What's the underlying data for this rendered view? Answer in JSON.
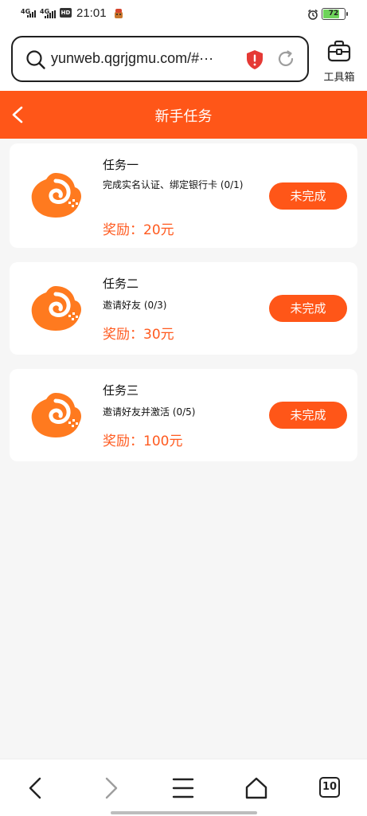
{
  "status_bar": {
    "network_1": "4G",
    "network_2": "4G",
    "hd": "HD",
    "time": "21:01",
    "battery": "72"
  },
  "browser": {
    "url": "yunweb.qgrjgmu.com/#···",
    "toolbox_label": "工具箱",
    "tab_count": "10"
  },
  "page": {
    "title": "新手任务"
  },
  "tasks": [
    {
      "title": "任务一",
      "desc": "完成实名认证、绑定银行卡 (0/1)",
      "reward": "奖励：20元",
      "status": "未完成"
    },
    {
      "title": "任务二",
      "desc": "邀请好友 (0/3)",
      "reward": "奖励：30元",
      "status": "未完成"
    },
    {
      "title": "任务三",
      "desc": "邀请好友并激活 (0/5)",
      "reward": "奖励：100元",
      "status": "未完成"
    }
  ],
  "colors": {
    "accent": "#ff5618",
    "reward": "#ff5a1f",
    "battery": "#6ed45a"
  },
  "icons": [
    "search-icon",
    "security-shield-icon",
    "reload-icon",
    "toolbox-icon",
    "back-arrow-icon",
    "app-logo-icon",
    "nav-back-icon",
    "nav-forward-icon",
    "menu-icon",
    "home-icon"
  ]
}
